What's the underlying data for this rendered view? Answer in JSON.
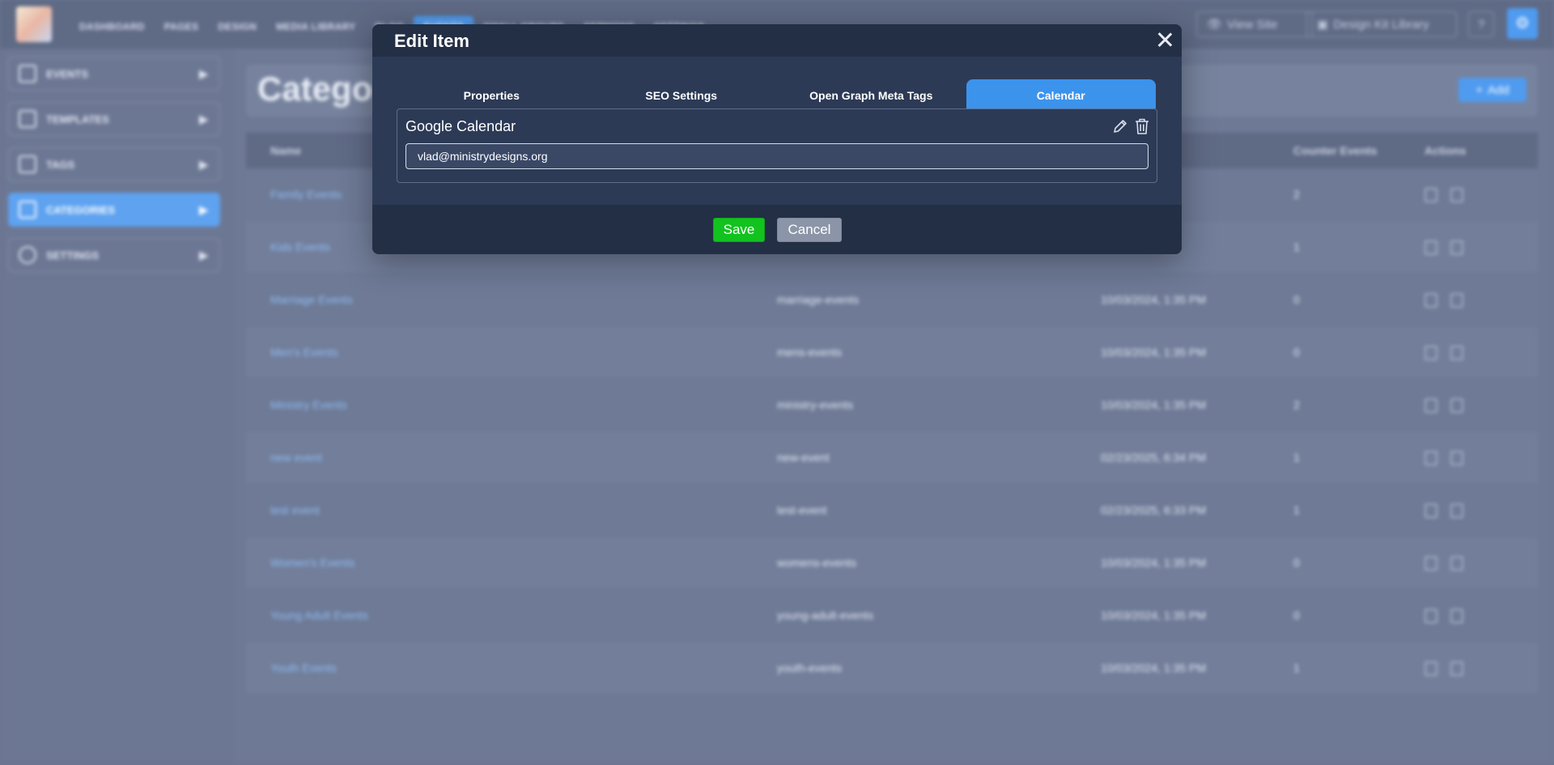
{
  "topbar": {
    "nav": [
      "DASHBOARD",
      "PAGES",
      "DESIGN",
      "MEDIA LIBRARY",
      "BLOG",
      "EVENTS",
      "SMALL GROUPS",
      "SERMONS",
      "SETTINGS"
    ],
    "active_nav": "EVENTS",
    "view_site": "View Site",
    "design_kit": "Design Kit Library",
    "help": "?"
  },
  "sidebar": {
    "items": [
      {
        "label": "EVENTS"
      },
      {
        "label": "TEMPLATES"
      },
      {
        "label": "TAGS"
      },
      {
        "label": "CATEGORIES"
      },
      {
        "label": "SETTINGS"
      }
    ],
    "active": "CATEGORIES"
  },
  "content": {
    "title": "Categories",
    "add_label": "Add",
    "columns": {
      "name": "Name",
      "counter": "Counter Events",
      "actions": "Actions"
    },
    "rows": [
      {
        "name": "Family Events",
        "slug": "",
        "date": "",
        "count": "2"
      },
      {
        "name": "Kids Events",
        "slug": "",
        "date": "",
        "count": "1"
      },
      {
        "name": "Marriage Events",
        "slug": "marriage-events",
        "date": "10/03/2024, 1:35 PM",
        "count": "0"
      },
      {
        "name": "Men's Events",
        "slug": "mens-events",
        "date": "10/03/2024, 1:35 PM",
        "count": "0"
      },
      {
        "name": "Ministry Events",
        "slug": "ministry-events",
        "date": "10/03/2024, 1:35 PM",
        "count": "2"
      },
      {
        "name": "new event",
        "slug": "new-event",
        "date": "02/23/2025, 6:34 PM",
        "count": "1"
      },
      {
        "name": "test event",
        "slug": "test-event",
        "date": "02/23/2025, 6:33 PM",
        "count": "1"
      },
      {
        "name": "Women's Events",
        "slug": "womens-events",
        "date": "10/03/2024, 1:35 PM",
        "count": "0"
      },
      {
        "name": "Young Adult Events",
        "slug": "young-adult-events",
        "date": "10/03/2024, 1:35 PM",
        "count": "0"
      },
      {
        "name": "Youth Events",
        "slug": "youth-events",
        "date": "10/03/2024, 1:35 PM",
        "count": "1"
      }
    ]
  },
  "modal": {
    "title": "Edit Item",
    "tabs": [
      {
        "label": "Properties"
      },
      {
        "label": "SEO Settings"
      },
      {
        "label": "Open Graph Meta Tags"
      },
      {
        "label": "Calendar"
      }
    ],
    "active_tab": "Calendar",
    "calendar": {
      "title": "Google Calendar",
      "email": "vlad@ministrydesigns.org"
    },
    "save_label": "Save",
    "cancel_label": "Cancel"
  },
  "colors": {
    "accent": "#3c93ec",
    "save": "#12c21f",
    "modal_bg": "#2c3a56",
    "modal_header": "#232f45"
  }
}
